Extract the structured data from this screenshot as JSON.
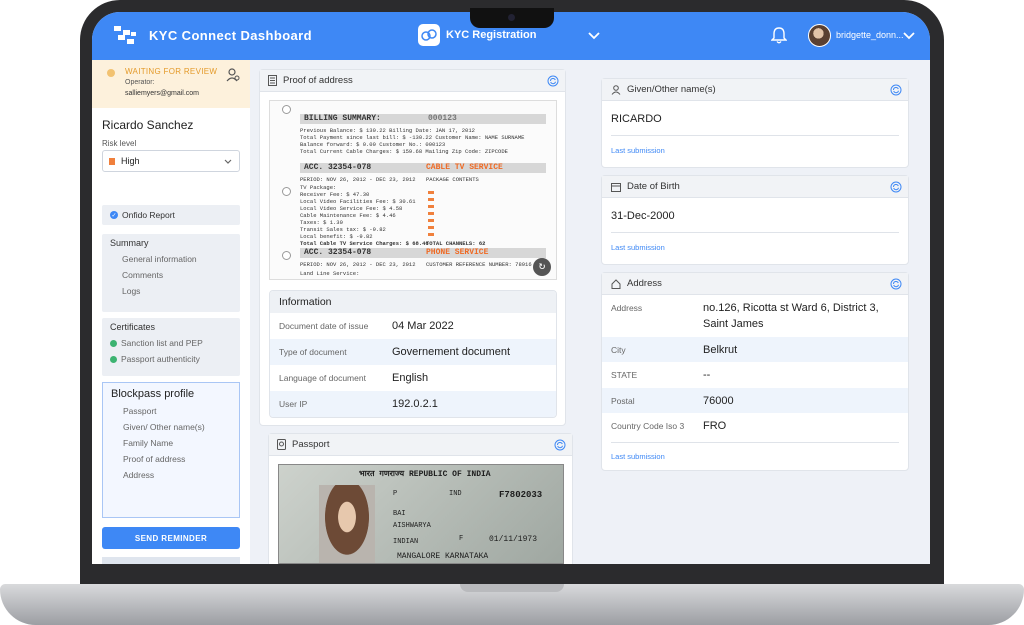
{
  "app": {
    "title": "KYC Connect Dashboard",
    "module": "KYC Registration",
    "username": "bridgette_donn..."
  },
  "sidebar": {
    "status": "WAITING FOR REVIEW",
    "operator_label": "Operator:",
    "operator_email": "salliemyers@gmail.com",
    "person_name": "Ricardo Sanchez",
    "risk_label": "Risk level",
    "risk_value": "High",
    "onfido": "Onfido Report",
    "summary": {
      "title": "Summary",
      "items": [
        "General information",
        "Comments",
        "Logs"
      ]
    },
    "certificates": {
      "title": "Certificates",
      "items": [
        "Sanction list and PEP",
        "Passport authenticity"
      ]
    },
    "blockpass": {
      "title": "Blockpass profile",
      "items": [
        "Passport",
        "Given/ Other name(s)",
        "Family Name",
        "Proof of address",
        "Address"
      ]
    },
    "reminder_button": "SEND REMINDER"
  },
  "proof": {
    "title": "Proof of address",
    "document": {
      "billing_summary": "BILLING SUMMARY:",
      "billing_no": "000123",
      "summary_rows": [
        "Previous  Balance:                 $  130.22    Billing Date:          JAN 17, 2012",
        "Total Payment since last bill:     $ -130.22    Customer Name:         NAME SURNAME",
        "Balance forward:                   $    0.00    Customer No.:          000123",
        "Total Current Cable Charges:       $  159.68    Mailing Zip Code:      ZIPCODE"
      ],
      "acc_label": "ACC. 32354-078",
      "cable_title": "CABLE TV SERVICE",
      "period": "PERIOD: NOV 26, 2012 - DEC 23, 2012",
      "package_contents": "PACKAGE CONTENTS",
      "cable_rows": [
        "TV Package:",
        "Receiver Fee:               $    47.30",
        "Local Video Facilities Fee: $    30.61",
        "Local Video Service Fee:    $     4.58",
        "Cable Maintenance Fee:      $     4.46",
        "Taxes:                      $     1.30",
        "Transit Sales tax:          $    -9.82",
        "Local benefit:              $    -9.82"
      ],
      "cable_total": "Total Cable TV Service Charges:   $   68.46",
      "total_channels": "TOTAL CHANNELS:",
      "total_channels_value": "62",
      "phone_title": "PHONE SERVICE",
      "customer_ref": "CUSTOMER REFERENCE NUMBER:",
      "customer_ref_value": "78916",
      "land_line": "Land Line Service:"
    },
    "info": {
      "title": "Information",
      "rows": [
        {
          "label": "Document date of issue",
          "value": "04 Mar 2022"
        },
        {
          "label": "Type of document",
          "value": "Governement document"
        },
        {
          "label": "Language of document",
          "value": "English"
        },
        {
          "label": "User IP",
          "value": "192.0.2.1"
        }
      ]
    }
  },
  "passport": {
    "title": "Passport",
    "image_text": {
      "header": "भारत गणराज्य  REPUBLIC OF INDIA",
      "type": "P",
      "code": "IND",
      "number": "F7802033",
      "surname": "BAI",
      "given_name": "AISHWARYA",
      "nationality": "INDIAN",
      "sex": "F",
      "dob": "01/11/1973",
      "place": "MANGALORE KARNATAKA"
    }
  },
  "given_name_card": {
    "title": "Given/Other name(s)",
    "value": "RICARDO",
    "link": "Last submission"
  },
  "dob_card": {
    "title": "Date of Birth",
    "value": "31-Dec-2000",
    "link": "Last submission"
  },
  "address_card": {
    "title": "Address",
    "rows": [
      {
        "label": "Address",
        "value": "no.126, Ricotta st Ward 6, District 3, Saint James"
      },
      {
        "label": "City",
        "value": "Belkrut"
      },
      {
        "label": "STATE",
        "value": "--"
      },
      {
        "label": "Postal",
        "value": "76000"
      },
      {
        "label": "Country Code Iso 3",
        "value": "FRO"
      }
    ],
    "link": "Last submission"
  },
  "colors": {
    "primary": "#3e88f5",
    "waiting": "#e49a2a",
    "success": "#3cb371",
    "risk_high": "#f0803c"
  }
}
